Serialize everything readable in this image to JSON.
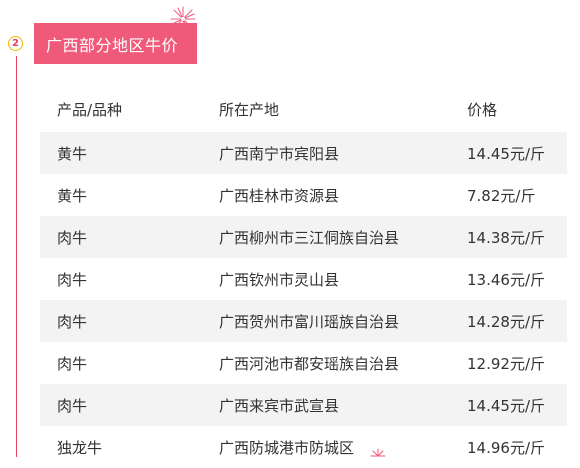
{
  "section": {
    "step_number": "2",
    "title": "广西部分地区牛价"
  },
  "table": {
    "headers": [
      "产品/品种",
      "所在产地",
      "价格"
    ],
    "rows": [
      [
        "黄牛",
        "广西南宁市宾阳县",
        "14.45元/斤"
      ],
      [
        "黄牛",
        "广西桂林市资源县",
        "7.82元/斤"
      ],
      [
        "肉牛",
        "广西柳州市三江侗族自治县",
        "14.38元/斤"
      ],
      [
        "肉牛",
        "广西钦州市灵山县",
        "13.46元/斤"
      ],
      [
        "肉牛",
        "广西贺州市富川瑶族自治县",
        "14.28元/斤"
      ],
      [
        "肉牛",
        "广西河池市都安瑶族自治县",
        "12.92元/斤"
      ],
      [
        "肉牛",
        "广西来宾市武宣县",
        "14.45元/斤"
      ],
      [
        "独龙牛",
        "广西防城港市防城区",
        "14.96元/斤"
      ]
    ]
  },
  "colors": {
    "accent": "#e2445c",
    "title_bg": "#f05a7a",
    "badge_border": "#f0b400",
    "row_stripe": "#f3f3f3"
  },
  "icons": [
    "firework-icon"
  ]
}
